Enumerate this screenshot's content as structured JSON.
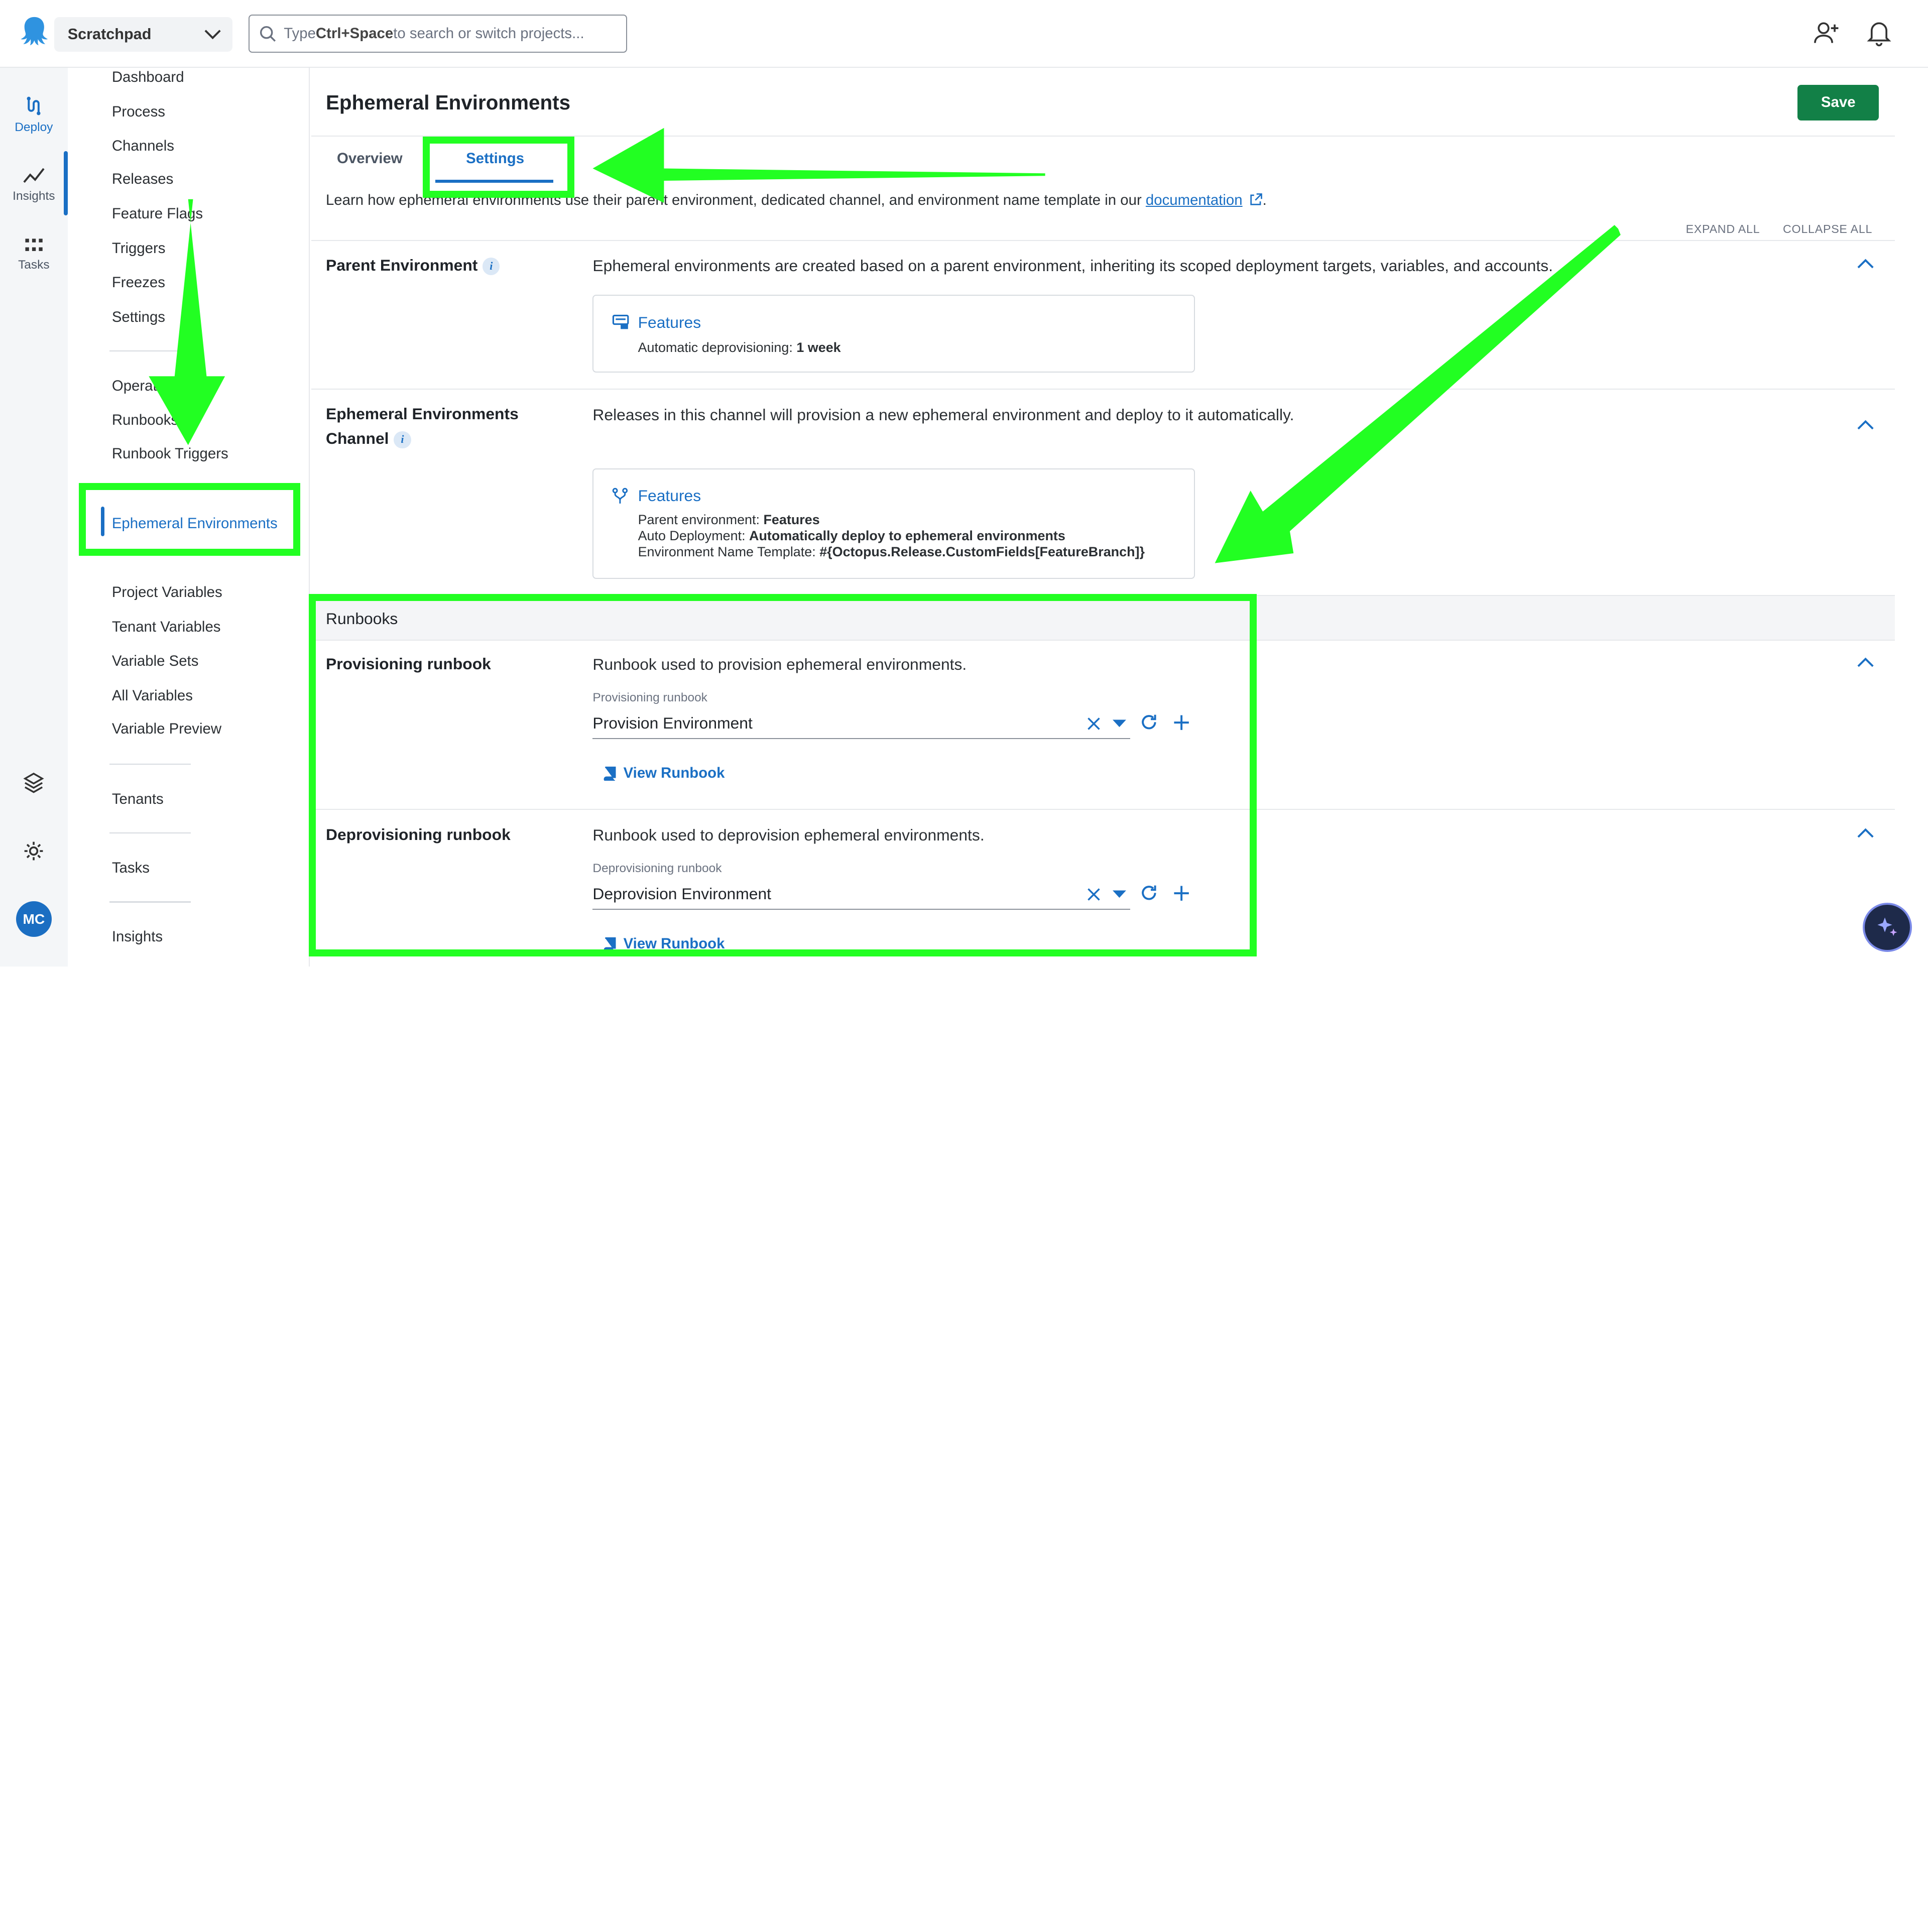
{
  "topbar": {
    "project_name": "Scratchpad",
    "search_text_pre": "Type ",
    "search_text_key": "Ctrl+Space",
    "search_text_post": " to search or switch projects..."
  },
  "rail": {
    "deploy": "Deploy",
    "insights": "Insights",
    "tasks": "Tasks",
    "avatar": "MC"
  },
  "subnav": {
    "items": [
      "Dashboard",
      "Process",
      "Channels",
      "Releases",
      "Feature Flags",
      "Triggers",
      "Freezes",
      "Settings",
      "Operations",
      "Runbooks",
      "Runbook Triggers",
      "Ephemeral Environments",
      "Project Variables",
      "Tenant Variables",
      "Variable Sets",
      "All Variables",
      "Variable Preview",
      "Tenants",
      "Tasks",
      "Insights"
    ]
  },
  "main": {
    "title": "Ephemeral Environments",
    "save_label": "Save",
    "tabs": [
      "Overview",
      "Settings"
    ],
    "intro_pre": "Learn how ephemeral environments use their parent environment, dedicated channel, and environment name template in our ",
    "intro_link": "documentation",
    "intro_post": ".",
    "expand_all": "EXPAND ALL",
    "collapse_all": "COLLAPSE ALL",
    "parent": {
      "label": "Parent Environment",
      "desc": "Ephemeral environments are created based on a parent environment, inheriting its scoped deployment targets, variables, and accounts.",
      "card_title": "Features",
      "line1_label": "Automatic deprovisioning: ",
      "line1_value": "1 week"
    },
    "channel": {
      "label_line1": "Ephemeral Environments",
      "label_line2": "Channel",
      "desc": "Releases in this channel will provision a new ephemeral environment and deploy to it automatically.",
      "card_title": "Features",
      "line1_label": "Parent environment: ",
      "line1_value": "Features",
      "line2_label": "Auto Deployment: ",
      "line2_value": "Automatically deploy to ephemeral environments",
      "line3_label": "Environment Name Template: ",
      "line3_value": "#{Octopus.Release.CustomFields[FeatureBranch]}"
    },
    "runbooks_header": "Runbooks",
    "provisioning": {
      "label": "Provisioning runbook",
      "desc": "Runbook used to provision ephemeral environments.",
      "field_label": "Provisioning runbook",
      "value": "Provision Environment",
      "view_link": "View Runbook"
    },
    "deprovisioning": {
      "label": "Deprovisioning runbook",
      "desc": "Runbook used to deprovision ephemeral environments.",
      "field_label": "Deprovisioning runbook",
      "value": "Deprovision Environment",
      "view_link": "View Runbook"
    }
  },
  "colors": {
    "accent": "#1a6fc4",
    "save": "#128047",
    "annotation": "#22ff22"
  }
}
